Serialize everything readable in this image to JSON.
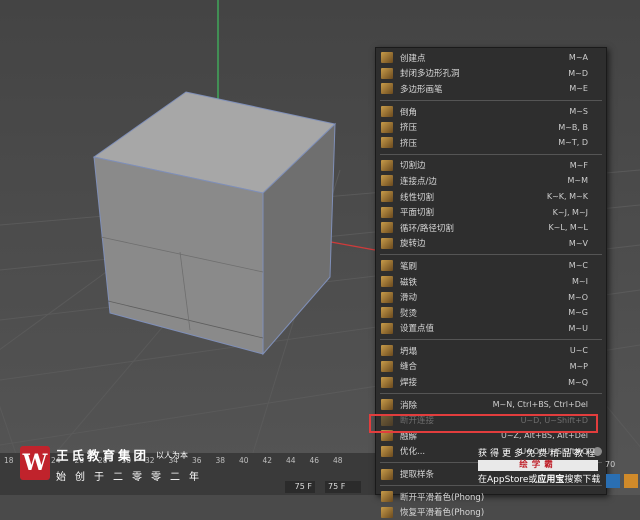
{
  "menu": {
    "groups": [
      [
        {
          "label": "创建点",
          "shortcut": "M~A",
          "icon": "create-point-icon"
        },
        {
          "label": "封闭多边形孔洞",
          "shortcut": "M~D",
          "icon": "close-polygon-hole-icon"
        },
        {
          "label": "多边形画笔",
          "shortcut": "M~E",
          "icon": "polygon-pen-icon"
        }
      ],
      [
        {
          "label": "倒角",
          "shortcut": "M~S",
          "icon": "bevel-icon"
        },
        {
          "label": "挤压",
          "shortcut": "M~B, B",
          "icon": "bridge-icon"
        },
        {
          "label": "挤压",
          "shortcut": "M~T, D",
          "icon": "extrude-icon"
        }
      ],
      [
        {
          "label": "切割边",
          "shortcut": "M~F",
          "icon": "cut-edges-icon"
        },
        {
          "label": "连接点/边",
          "shortcut": "M~M",
          "icon": "connect-points-edges-icon"
        },
        {
          "label": "线性切割",
          "shortcut": "K~K, M~K",
          "icon": "line-cut-icon"
        },
        {
          "label": "平面切割",
          "shortcut": "K~J, M~J",
          "icon": "plane-cut-icon"
        },
        {
          "label": "循环/路径切割",
          "shortcut": "K~L, M~L",
          "icon": "loop-path-cut-icon"
        },
        {
          "label": "旋转边",
          "shortcut": "M~V",
          "icon": "spin-edge-icon"
        }
      ],
      [
        {
          "label": "笔刷",
          "shortcut": "M~C",
          "icon": "brush-icon"
        },
        {
          "label": "磁铁",
          "shortcut": "M~I",
          "icon": "magnet-icon"
        },
        {
          "label": "滑动",
          "shortcut": "M~O",
          "icon": "slide-icon"
        },
        {
          "label": "熨烫",
          "shortcut": "M~G",
          "icon": "iron-icon"
        },
        {
          "label": "设置点值",
          "shortcut": "M~U",
          "icon": "set-point-value-icon"
        }
      ],
      [
        {
          "label": "坍塌",
          "shortcut": "U~C",
          "icon": "collapse-icon"
        },
        {
          "label": "缝合",
          "shortcut": "M~P",
          "icon": "stitch-icon"
        },
        {
          "label": "焊接",
          "shortcut": "M~Q",
          "icon": "weld-icon"
        }
      ],
      [
        {
          "label": "消除",
          "shortcut": "M~N, Ctrl+BS, Ctrl+Del",
          "icon": "dissolve-icon"
        },
        {
          "label": "断开连接",
          "shortcut": "U~D, U~Shift+D",
          "icon": "disconnect-icon",
          "disabled": true
        },
        {
          "label": "融解",
          "shortcut": "U~Z, Alt+BS, Alt+Del",
          "icon": "melt-icon"
        },
        {
          "label": "优化...",
          "shortcut": "U~O, U~Shift+O",
          "icon": "optimize-icon",
          "gear": true
        }
      ],
      [
        {
          "label": "提取样条",
          "shortcut": "",
          "icon": "extract-spline-icon"
        }
      ],
      [
        {
          "label": "断开平滑着色(Phong)",
          "shortcut": "",
          "icon": "break-phong-icon"
        },
        {
          "label": "恢复平滑着色(Phong)",
          "shortcut": "",
          "icon": "restore-phong-icon"
        }
      ]
    ]
  },
  "timeline": {
    "ruler": [
      "18",
      "22",
      "24",
      "26",
      "28",
      "30",
      "32",
      "34",
      "36",
      "38",
      "40",
      "42",
      "44",
      "46",
      "48"
    ],
    "frame_a": "75 F",
    "frame_b": "75 F"
  },
  "watermark": {
    "logo": "W",
    "title": "王氏教育集团",
    "slogan": "以人为本",
    "subtitle": "始创于二零零二年"
  },
  "promo": {
    "line1": "获得更多免费精品教程",
    "badge": "绘学霸",
    "number": "70",
    "line2_pre": "在",
    "line2_store": "AppStore",
    "line2_mid": "或",
    "line2_app": "应用宝",
    "line2_post": "搜索下载"
  },
  "colors": {
    "viewport_bg": "#4a4a4a",
    "menu_bg": "#2e2e2e",
    "highlight": "#e23d3d",
    "axis_y": "#3fbf5f",
    "axis_x": "#d03a3a",
    "cube_front": "#8a8a8a",
    "cube_top": "#a7a7a7",
    "cube_side": "#6f6f6f"
  }
}
